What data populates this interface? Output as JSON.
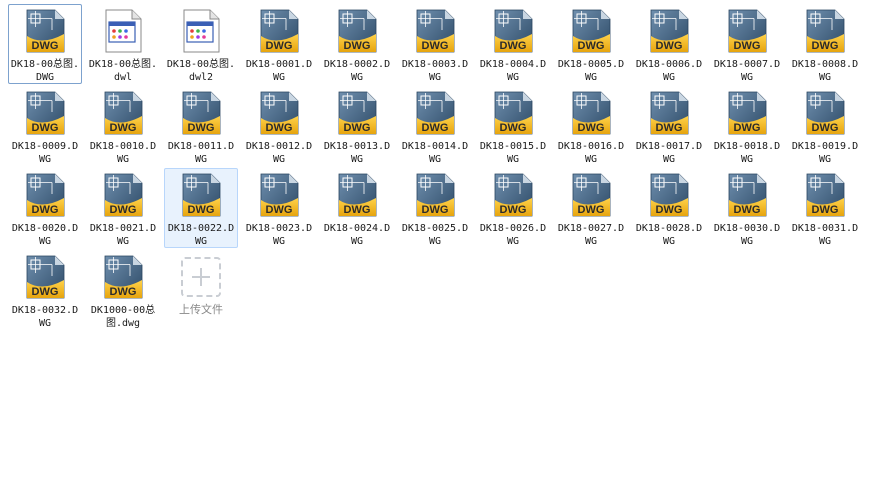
{
  "colors": {
    "dwg_blue": "#3a5a7a",
    "dwg_gold": "#f2b619",
    "selection_border": "#7da2ce",
    "hover_bg": "#e8f2fd"
  },
  "files": [
    {
      "name": "DK18-00总图.DWG",
      "icon": "dwg-file-icon",
      "badge": "DWG",
      "state": "selected"
    },
    {
      "name": "DK18-00总图.dwl",
      "icon": "generic-file-icon",
      "badge": "",
      "state": ""
    },
    {
      "name": "DK18-00总图.dwl2",
      "icon": "generic-file-icon",
      "badge": "",
      "state": ""
    },
    {
      "name": "DK18-0001.DWG",
      "icon": "dwg-file-icon",
      "badge": "DWG",
      "state": ""
    },
    {
      "name": "DK18-0002.DWG",
      "icon": "dwg-file-icon",
      "badge": "DWG",
      "state": ""
    },
    {
      "name": "DK18-0003.DWG",
      "icon": "dwg-file-icon",
      "badge": "DWG",
      "state": ""
    },
    {
      "name": "DK18-0004.DWG",
      "icon": "dwg-file-icon",
      "badge": "DWG",
      "state": ""
    },
    {
      "name": "DK18-0005.DWG",
      "icon": "dwg-file-icon",
      "badge": "DWG",
      "state": ""
    },
    {
      "name": "DK18-0006.DWG",
      "icon": "dwg-file-icon",
      "badge": "DWG",
      "state": ""
    },
    {
      "name": "DK18-0007.DWG",
      "icon": "dwg-file-icon",
      "badge": "DWG",
      "state": ""
    },
    {
      "name": "DK18-0008.DWG",
      "icon": "dwg-file-icon",
      "badge": "DWG",
      "state": ""
    },
    {
      "name": "DK18-0009.DWG",
      "icon": "dwg-file-icon",
      "badge": "DWG",
      "state": ""
    },
    {
      "name": "DK18-0010.DWG",
      "icon": "dwg-file-icon",
      "badge": "DWG",
      "state": ""
    },
    {
      "name": "DK18-0011.DWG",
      "icon": "dwg-file-icon",
      "badge": "DWG",
      "state": ""
    },
    {
      "name": "DK18-0012.DWG",
      "icon": "dwg-file-icon",
      "badge": "DWG",
      "state": ""
    },
    {
      "name": "DK18-0013.DWG",
      "icon": "dwg-file-icon",
      "badge": "DWG",
      "state": ""
    },
    {
      "name": "DK18-0014.DWG",
      "icon": "dwg-file-icon",
      "badge": "DWG",
      "state": ""
    },
    {
      "name": "DK18-0015.DWG",
      "icon": "dwg-file-icon",
      "badge": "DWG",
      "state": ""
    },
    {
      "name": "DK18-0016.DWG",
      "icon": "dwg-file-icon",
      "badge": "DWG",
      "state": ""
    },
    {
      "name": "DK18-0017.DWG",
      "icon": "dwg-file-icon",
      "badge": "DWG",
      "state": ""
    },
    {
      "name": "DK18-0018.DWG",
      "icon": "dwg-file-icon",
      "badge": "DWG",
      "state": ""
    },
    {
      "name": "DK18-0019.DWG",
      "icon": "dwg-file-icon",
      "badge": "DWG",
      "state": ""
    },
    {
      "name": "DK18-0020.DWG",
      "icon": "dwg-file-icon",
      "badge": "DWG",
      "state": ""
    },
    {
      "name": "DK18-0021.DWG",
      "icon": "dwg-file-icon",
      "badge": "DWG",
      "state": ""
    },
    {
      "name": "DK18-0022.DWG",
      "icon": "dwg-file-icon",
      "badge": "DWG",
      "state": "hover"
    },
    {
      "name": "DK18-0023.DWG",
      "icon": "dwg-file-icon",
      "badge": "DWG",
      "state": ""
    },
    {
      "name": "DK18-0024.DWG",
      "icon": "dwg-file-icon",
      "badge": "DWG",
      "state": ""
    },
    {
      "name": "DK18-0025.DWG",
      "icon": "dwg-file-icon",
      "badge": "DWG",
      "state": ""
    },
    {
      "name": "DK18-0026.DWG",
      "icon": "dwg-file-icon",
      "badge": "DWG",
      "state": ""
    },
    {
      "name": "DK18-0027.DWG",
      "icon": "dwg-file-icon",
      "badge": "DWG",
      "state": ""
    },
    {
      "name": "DK18-0028.DWG",
      "icon": "dwg-file-icon",
      "badge": "DWG",
      "state": ""
    },
    {
      "name": "DK18-0030.DWG",
      "icon": "dwg-file-icon",
      "badge": "DWG",
      "state": ""
    },
    {
      "name": "DK18-0031.DWG",
      "icon": "dwg-file-icon",
      "badge": "DWG",
      "state": ""
    },
    {
      "name": "DK18-0032.DWG",
      "icon": "dwg-file-icon",
      "badge": "DWG",
      "state": ""
    },
    {
      "name": "DK1000-00总图.dwg",
      "icon": "dwg-file-icon",
      "badge": "DWG",
      "state": ""
    }
  ],
  "upload": {
    "label": "上传文件",
    "icon": "plus-icon"
  }
}
